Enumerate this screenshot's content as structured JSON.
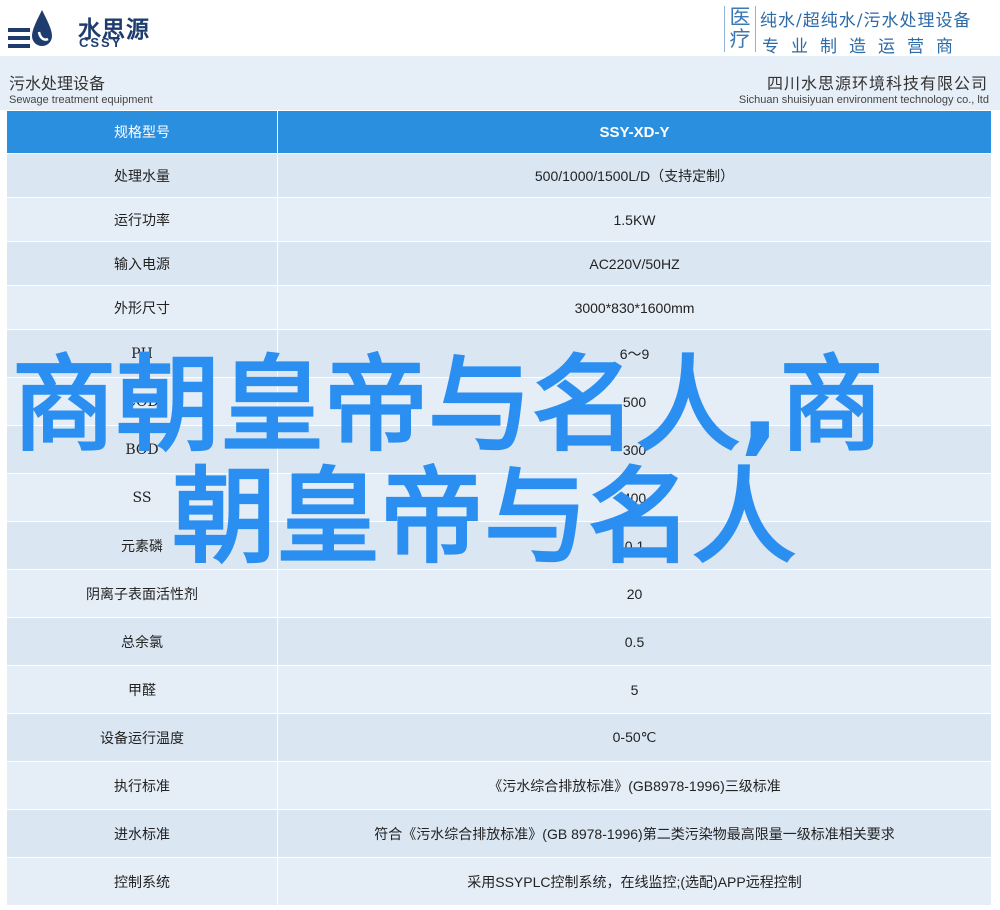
{
  "brand": {
    "name_cn": "水思源",
    "name_en": "CSSY",
    "category_chars": [
      "医",
      "疗"
    ],
    "tagline_1": "纯水/超纯水/污水处理设备",
    "tagline_2": "专业制造运营商",
    "accent_color": "#2b8fe0",
    "logo_color": "#1e3d6e"
  },
  "subheader": {
    "product_cn": "污水处理设备",
    "product_en": "Sewage treatment equipment",
    "company_cn": "四川水思源环境科技有限公司",
    "company_en": "Sichuan shuisiyuan environment technology co., ltd"
  },
  "table": {
    "header": {
      "key": "规格型号",
      "value": "SSY-XD-Y"
    },
    "rows": [
      {
        "key": "处理水量",
        "value": "500/1000/1500L/D（支持定制）"
      },
      {
        "key": "运行功率",
        "value": "1.5KW"
      },
      {
        "key": "输入电源",
        "value": "AC220V/50HZ"
      },
      {
        "key": "外形尺寸",
        "value": "3000*830*1600mm"
      },
      {
        "key": "PH",
        "value": "6～9"
      },
      {
        "key": "COD",
        "value": "500"
      },
      {
        "key": "BOD",
        "value": "300"
      },
      {
        "key": "SS",
        "value": "400"
      },
      {
        "key": "元素磷",
        "value": "0.1"
      },
      {
        "key": "阴离子表面活性剂",
        "value": "20"
      },
      {
        "key": "总余氯",
        "value": "0.5"
      },
      {
        "key": "甲醛",
        "value": "5"
      },
      {
        "key": "设备运行温度",
        "value": "0-50℃"
      },
      {
        "key": "执行标准",
        "value": "《污水综合排放标准》(GB8978-1996)三级标准"
      },
      {
        "key": "进水标准",
        "value": "符合《污水综合排放标准》(GB 8978-1996)第二类污染物最高限量一级标准相关要求"
      },
      {
        "key": "控制系统",
        "value": "采用SSYPLC控制系统，在线监控;(选配)APP远程控制"
      }
    ]
  },
  "overlay": {
    "line1": "商朝皇帝与名人,商",
    "line2": "朝皇帝与名人",
    "color": "#2a8ff0"
  }
}
